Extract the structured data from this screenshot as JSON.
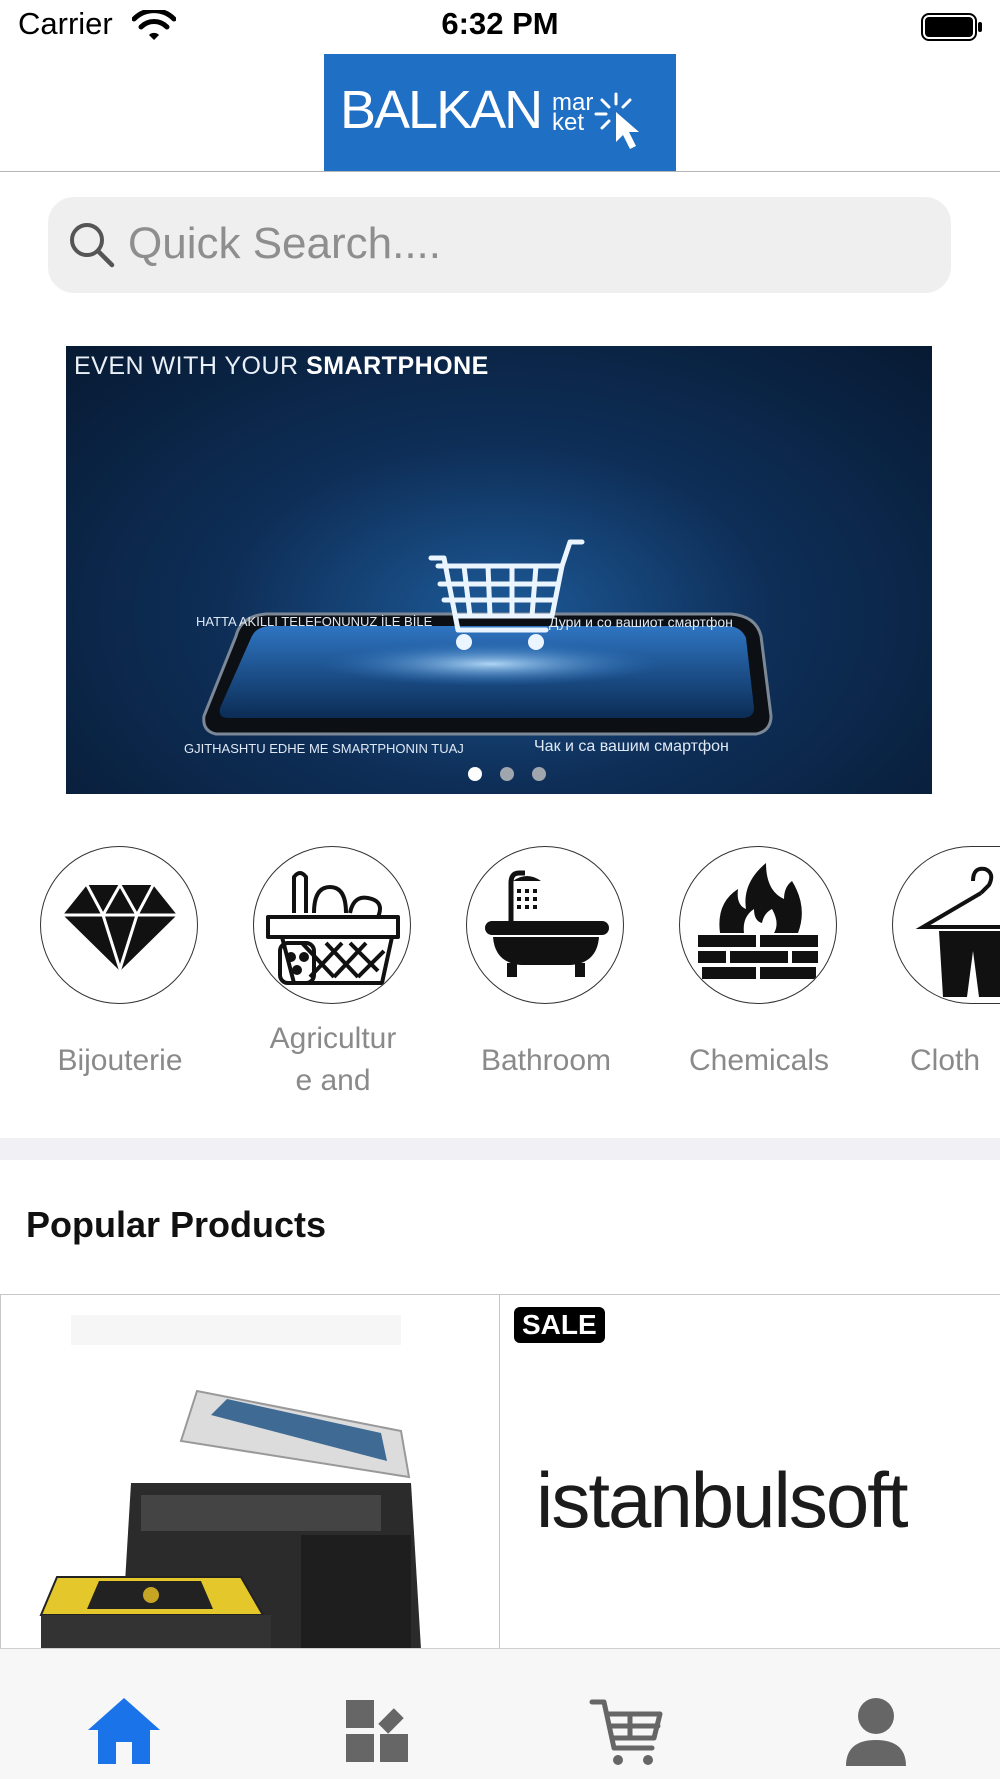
{
  "status_bar": {
    "carrier": "Carrier",
    "time": "6:32 PM"
  },
  "header": {
    "logo_text_main": "BALKAN",
    "logo_text_sub1": "mar",
    "logo_text_sub2": "ket"
  },
  "search": {
    "placeholder": "Quick Search...."
  },
  "banner": {
    "headline_light": "EVEN WITH YOUR ",
    "headline_bold": "SMARTPHONE",
    "line_tr": "HATTA AKILLI TELEFONUNUZ İLE BİLE",
    "line_mk1": "Дури и со вашиот смартфон",
    "line_al": "GJITHASHTU EDHE ME SMARTPHONIN TUAJ",
    "line_mk2": "Чак и са вашим смартфон",
    "active_slide": 1,
    "slide_count": 3
  },
  "categories": [
    {
      "label": "Bijouterie",
      "icon": "diamond-icon"
    },
    {
      "label": "Agricultur e and",
      "label_line1": "Agricultur",
      "label_line2": "e and",
      "icon": "food-basket-icon"
    },
    {
      "label": "Bathroom",
      "icon": "bathtub-icon"
    },
    {
      "label": "Chemicals",
      "icon": "fire-wall-icon"
    },
    {
      "label": "Cloth",
      "icon": "clothes-hanger-icon"
    }
  ],
  "popular": {
    "title": "Popular Products",
    "products": [
      {
        "image": "t-shirt-printer-image"
      },
      {
        "badge": "SALE",
        "brand": "istanbulsoft"
      }
    ]
  },
  "tab_bar": {
    "active_tab": "home",
    "tabs": [
      "home-icon",
      "categories-icon",
      "cart-icon",
      "account-icon"
    ],
    "active_color": "#1a73e8",
    "inactive_color": "#666666"
  },
  "colors": {
    "logo_bg": "#1f6fc5",
    "sale_check": "#f26b1d"
  }
}
